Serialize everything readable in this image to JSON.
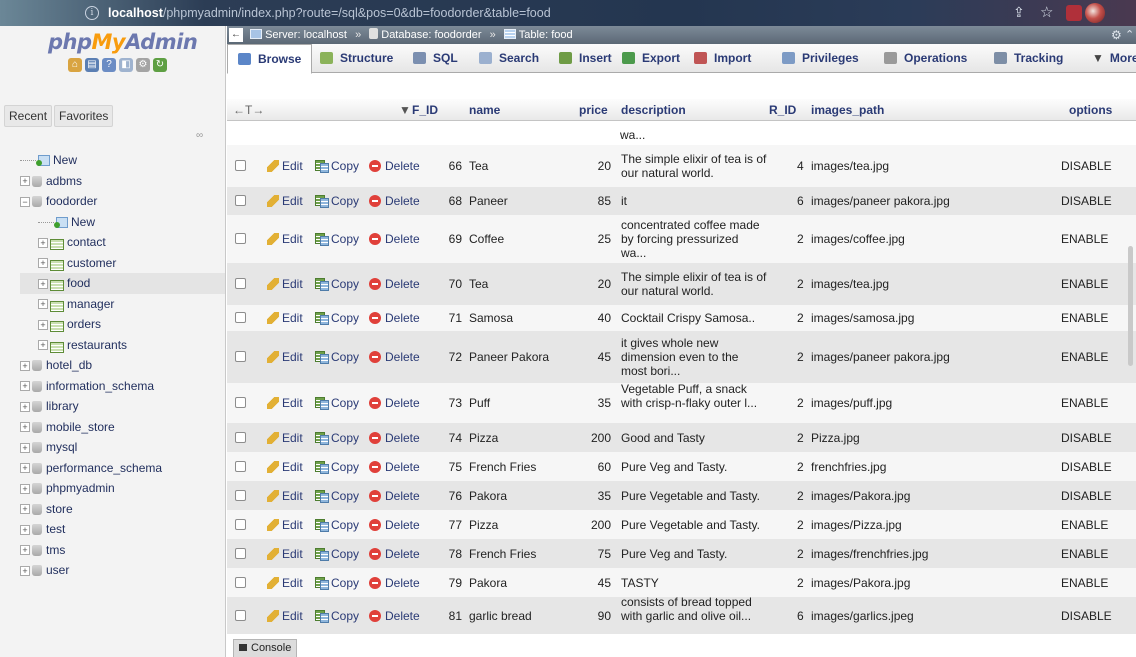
{
  "browser": {
    "url_host": "localhost",
    "url_path": "/phpmyadmin/index.php?route=/sql&pos=0&db=foodorder&table=food"
  },
  "nav": {
    "logo_php": "php",
    "logo_my": "My",
    "logo_admin": "Admin",
    "recent": "Recent",
    "favorites": "Favorites",
    "tree": [
      {
        "label": "New",
        "kind": "new",
        "level": 1
      },
      {
        "label": "adbms",
        "kind": "db",
        "level": 1
      },
      {
        "label": "foodorder",
        "kind": "db",
        "level": 1,
        "expanded": true
      },
      {
        "label": "New",
        "kind": "new",
        "level": 2
      },
      {
        "label": "contact",
        "kind": "table",
        "level": 2
      },
      {
        "label": "customer",
        "kind": "table",
        "level": 2
      },
      {
        "label": "food",
        "kind": "table",
        "level": 2,
        "selected": true
      },
      {
        "label": "manager",
        "kind": "table",
        "level": 2
      },
      {
        "label": "orders",
        "kind": "table",
        "level": 2
      },
      {
        "label": "restaurants",
        "kind": "table",
        "level": 2
      },
      {
        "label": "hotel_db",
        "kind": "db",
        "level": 1
      },
      {
        "label": "information_schema",
        "kind": "db",
        "level": 1
      },
      {
        "label": "library",
        "kind": "db",
        "level": 1
      },
      {
        "label": "mobile_store",
        "kind": "db",
        "level": 1
      },
      {
        "label": "mysql",
        "kind": "db",
        "level": 1
      },
      {
        "label": "performance_schema",
        "kind": "db",
        "level": 1
      },
      {
        "label": "phpmyadmin",
        "kind": "db",
        "level": 1
      },
      {
        "label": "store",
        "kind": "db",
        "level": 1
      },
      {
        "label": "test",
        "kind": "db",
        "level": 1
      },
      {
        "label": "tms",
        "kind": "db",
        "level": 1
      },
      {
        "label": "user",
        "kind": "db",
        "level": 1
      }
    ]
  },
  "breadcrumb": {
    "server": "Server: localhost",
    "database": "Database: foodorder",
    "table": "Table: food",
    "separator": "»"
  },
  "tabs": [
    {
      "label": "Browse",
      "icon": "browse-icon",
      "color": "#5b86c8"
    },
    {
      "label": "Structure",
      "icon": "structure-icon",
      "color": "#8bb35a"
    },
    {
      "label": "SQL",
      "icon": "sql-icon",
      "color": "#7b8fb0"
    },
    {
      "label": "Search",
      "icon": "search-icon",
      "color": "#9bb0cf"
    },
    {
      "label": "Insert",
      "icon": "insert-icon",
      "color": "#6f9c46"
    },
    {
      "label": "Export",
      "icon": "export-icon",
      "color": "#4c9a4c"
    },
    {
      "label": "Import",
      "icon": "import-icon",
      "color": "#c05555"
    },
    {
      "label": "Privileges",
      "icon": "privileges-icon",
      "color": "#7d9bc5"
    },
    {
      "label": "Operations",
      "icon": "operations-icon",
      "color": "#9a9a9a"
    },
    {
      "label": "Tracking",
      "icon": "tracking-icon",
      "color": "#7d8ea6"
    },
    {
      "label": "More",
      "icon": "more-icon",
      "color": "#555555"
    }
  ],
  "table": {
    "arrows": "←T→",
    "columns": {
      "f_id": "F_ID",
      "name": "name",
      "price": "price",
      "description": "description",
      "r_id": "R_ID",
      "images_path": "images_path",
      "options": "options"
    },
    "top_cut_text": "wa...",
    "actions": {
      "edit": "Edit",
      "copy": "Copy",
      "delete": "Delete"
    },
    "rows": [
      {
        "f_id": "66",
        "name": "Tea",
        "price": "20",
        "description": "The simple elixir of tea is of our natural world.",
        "r_id": "4",
        "images_path": "images/tea.jpg",
        "options": "DISABLE"
      },
      {
        "f_id": "68",
        "name": "Paneer",
        "price": "85",
        "description": "it",
        "r_id": "6",
        "images_path": "images/paneer pakora.jpg",
        "options": "DISABLE"
      },
      {
        "f_id": "69",
        "name": "Coffee",
        "price": "25",
        "description": "concentrated coffee made by forcing pressurized wa...",
        "r_id": "2",
        "images_path": "images/coffee.jpg",
        "options": "ENABLE"
      },
      {
        "f_id": "70",
        "name": "Tea",
        "price": "20",
        "description": "The simple elixir of tea is of our natural world.",
        "r_id": "2",
        "images_path": "images/tea.jpg",
        "options": "ENABLE"
      },
      {
        "f_id": "71",
        "name": "Samosa",
        "price": "40",
        "description": "Cocktail Crispy Samosa..",
        "r_id": "2",
        "images_path": "images/samosa.jpg",
        "options": "ENABLE"
      },
      {
        "f_id": "72",
        "name": "Paneer Pakora",
        "price": "45",
        "description": "it gives whole new dimension even to the most bori...",
        "r_id": "2",
        "images_path": "images/paneer pakora.jpg",
        "options": "ENABLE"
      },
      {
        "f_id": "73",
        "name": "Puff",
        "price": "35",
        "description": "Vegetable Puff, a snack with crisp-n-flaky outer l...",
        "r_id": "2",
        "images_path": "images/puff.jpg",
        "options": "ENABLE"
      },
      {
        "f_id": "74",
        "name": "Pizza",
        "price": "200",
        "description": "Good and Tasty",
        "r_id": "2",
        "images_path": "Pizza.jpg",
        "options": "DISABLE"
      },
      {
        "f_id": "75",
        "name": "French Fries",
        "price": "60",
        "description": "Pure Veg and Tasty.",
        "r_id": "2",
        "images_path": "frenchfries.jpg",
        "options": "DISABLE"
      },
      {
        "f_id": "76",
        "name": "Pakora",
        "price": "35",
        "description": "Pure Vegetable and Tasty.",
        "r_id": "2",
        "images_path": "images/Pakora.jpg",
        "options": "DISABLE"
      },
      {
        "f_id": "77",
        "name": "Pizza",
        "price": "200",
        "description": "Pure Vegetable and Tasty.",
        "r_id": "2",
        "images_path": "images/Pizza.jpg",
        "options": "ENABLE"
      },
      {
        "f_id": "78",
        "name": "French Fries",
        "price": "75",
        "description": "Pure Veg and Tasty.",
        "r_id": "2",
        "images_path": "images/frenchfries.jpg",
        "options": "ENABLE"
      },
      {
        "f_id": "79",
        "name": "Pakora",
        "price": "45",
        "description": "TASTY",
        "r_id": "2",
        "images_path": "images/Pakora.jpg",
        "options": "ENABLE"
      },
      {
        "f_id": "81",
        "name": "garlic bread",
        "price": "90",
        "description": "consists of bread topped with garlic and olive oil...",
        "r_id": "6",
        "images_path": "images/garlics.jpeg",
        "options": "DISABLE"
      }
    ]
  },
  "console_label": "Console"
}
